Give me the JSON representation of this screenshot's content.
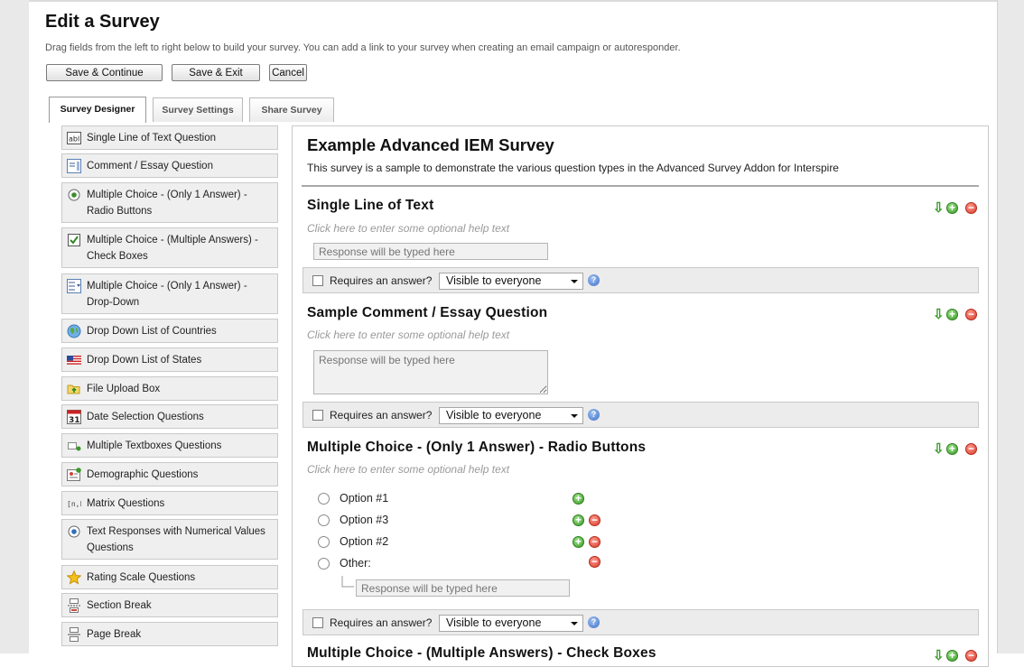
{
  "page": {
    "title": "Edit a Survey",
    "intro": "Drag fields from the left to right below to build your survey. You can add a link to your survey when creating an email campaign or autoresponder."
  },
  "toolbar": {
    "save_continue": "Save & Continue",
    "save_exit": "Save & Exit",
    "cancel": "Cancel"
  },
  "tabs": [
    {
      "label": "Survey Designer",
      "active": true
    },
    {
      "label": "Survey Settings",
      "active": false
    },
    {
      "label": "Share Survey",
      "active": false
    }
  ],
  "sidebar": {
    "items": [
      {
        "label": "Single Line of Text Question",
        "icon": "text-field-icon"
      },
      {
        "label": "Comment / Essay Question",
        "icon": "textarea-icon"
      },
      {
        "label": "Multiple Choice - (Only 1 Answer) - Radio Buttons",
        "icon": "radio-button-icon"
      },
      {
        "label": "Multiple Choice - (Multiple Answers) - Check Boxes",
        "icon": "checkbox-icon"
      },
      {
        "label": "Multiple Choice - (Only 1 Answer) - Drop-Down",
        "icon": "dropdown-icon"
      },
      {
        "label": "Drop Down List of Countries",
        "icon": "globe-icon"
      },
      {
        "label": "Drop Down List of States",
        "icon": "us-flag-icon"
      },
      {
        "label": "File Upload Box",
        "icon": "folder-upload-icon"
      },
      {
        "label": "Date Selection Questions",
        "icon": "calendar-icon"
      },
      {
        "label": "Multiple Textboxes Questions",
        "icon": "textboxes-icon"
      },
      {
        "label": "Demographic Questions",
        "icon": "demographic-icon"
      },
      {
        "label": "Matrix Questions",
        "icon": "matrix-icon"
      },
      {
        "label": "Text Responses with Numerical Values Questions",
        "icon": "radio-button-icon"
      },
      {
        "label": "Rating Scale Questions",
        "icon": "star-icon"
      },
      {
        "label": "Section Break",
        "icon": "section-break-icon"
      },
      {
        "label": "Page Break",
        "icon": "page-break-icon"
      }
    ]
  },
  "survey": {
    "title": "Example Advanced IEM Survey",
    "description": "This survey is a sample to demonstrate the various question types in the Advanced Survey Addon for Interspire",
    "help_placeholder": "Click here to enter some optional help text",
    "response_placeholder": "Response will be typed here",
    "requires_answer_label": "Requires an answer?",
    "visibility_value": "Visible to everyone",
    "help_glyph": "?",
    "questions": [
      {
        "title": "Single Line of Text"
      },
      {
        "title": "Sample Comment / Essay Question"
      },
      {
        "title": "Multiple Choice - (Only 1 Answer) - Radio Buttons",
        "options": [
          "Option #1",
          "Option #3",
          "Option #2",
          "Other:"
        ]
      },
      {
        "title": "Multiple Choice - (Multiple Answers) - Check Boxes"
      }
    ]
  },
  "icons": {
    "down": "⇩",
    "add": "+",
    "remove": "−"
  },
  "colors": {
    "add_green": "#3a9a27",
    "remove_red": "#d83b2b",
    "panel_border": "#c9c9c9",
    "bar_bg": "#ececec"
  }
}
